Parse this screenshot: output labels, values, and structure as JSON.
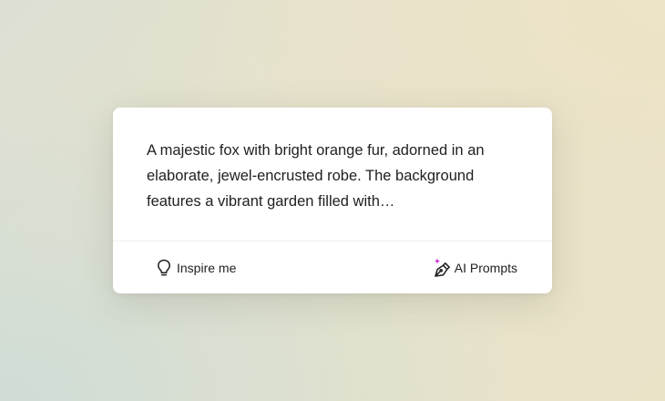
{
  "prompt": {
    "text": "A majestic fox with bright orange fur, adorned in an elaborate, jewel-encrusted robe. The background features a vibrant garden filled with…"
  },
  "actions": {
    "inspire_label": "Inspire me",
    "inspire_icon": "lightbulb-icon",
    "ai_prompts_label": "AI Prompts",
    "ai_prompts_icon": "pen-sparkle-icon"
  },
  "colors": {
    "card_bg": "#ffffff",
    "text": "#1f1f1f",
    "sparkle_accent": "#c531d6"
  }
}
